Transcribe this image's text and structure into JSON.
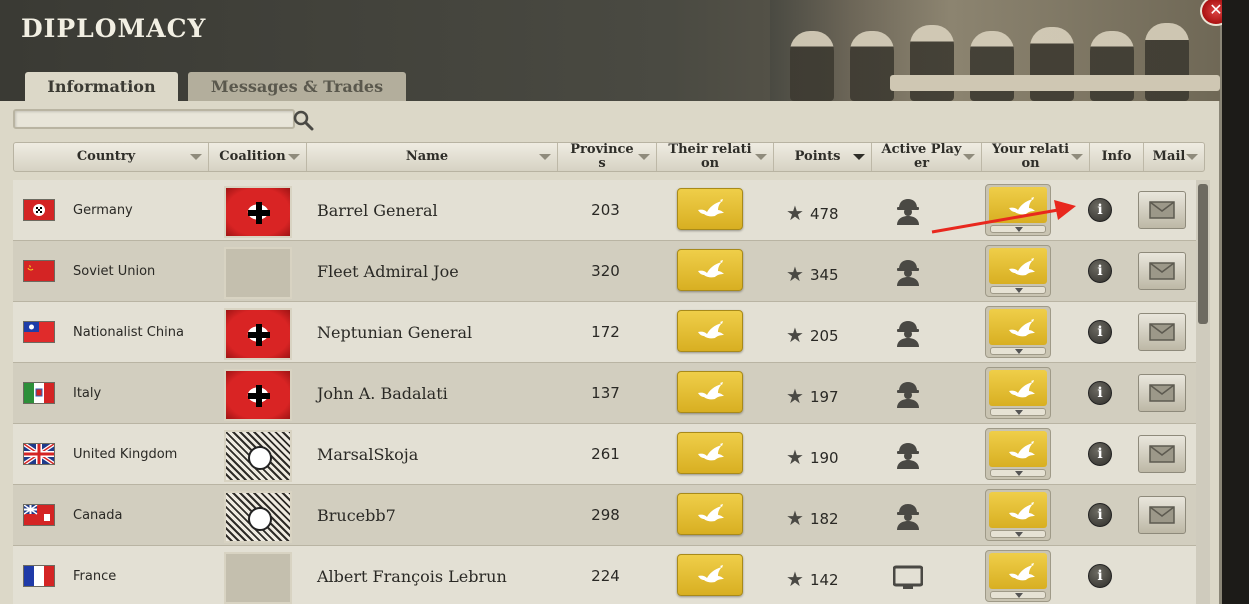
{
  "window": {
    "title": "DIPLOMACY",
    "close_label": "✕"
  },
  "tabs": [
    {
      "label": "Information",
      "active": true
    },
    {
      "label": "Messages & Trades",
      "active": false
    }
  ],
  "search": {
    "value": "",
    "placeholder": ""
  },
  "columns": {
    "country": "Country",
    "coalition": "Coalition",
    "name": "Name",
    "provinces": "Provinces",
    "their_relation": "Their relation",
    "points": "Points",
    "active_player": "Active Player",
    "your_relation": "Your relation",
    "info": "Info",
    "mail": "Mail"
  },
  "rows": [
    {
      "country": "Germany",
      "flag": "germany",
      "coalition": "banner",
      "name": "Barrel General",
      "provinces": "203",
      "points": "478",
      "player": "soldier"
    },
    {
      "country": "Soviet Union",
      "flag": "soviet",
      "coalition": "blank",
      "name": "Fleet Admiral Joe",
      "provinces": "320",
      "points": "345",
      "player": "soldier"
    },
    {
      "country": "Nationalist China",
      "flag": "china",
      "coalition": "banner",
      "name": "Neptunian General",
      "provinces": "172",
      "points": "205",
      "player": "soldier"
    },
    {
      "country": "Italy",
      "flag": "italy",
      "coalition": "banner",
      "name": "John A. Badalati",
      "provinces": "137",
      "points": "197",
      "player": "soldier"
    },
    {
      "country": "United Kingdom",
      "flag": "uk",
      "coalition": "collage",
      "name": "MarsalSkoja",
      "provinces": "261",
      "points": "190",
      "player": "soldier"
    },
    {
      "country": "Canada",
      "flag": "canada",
      "coalition": "collage",
      "name": "Brucebb7",
      "provinces": "298",
      "points": "182",
      "player": "soldier"
    },
    {
      "country": "France",
      "flag": "france",
      "coalition": "blank",
      "name": "Albert François Lebrun",
      "provinces": "224",
      "points": "142",
      "player": "computer"
    }
  ],
  "icons": {
    "search": "search-icon",
    "relation": "dove-icon",
    "points": "star-icon",
    "info": "info-icon",
    "mail": "envelope-icon",
    "player_human": "soldier-icon",
    "player_ai": "monitor-icon"
  },
  "colors": {
    "relation_yellow": "#e3bd33",
    "header_dark": "#3a3a34",
    "row_light": "#e3e0d4",
    "row_dark": "#d2cebf",
    "annotation_arrow": "#e8281e"
  }
}
